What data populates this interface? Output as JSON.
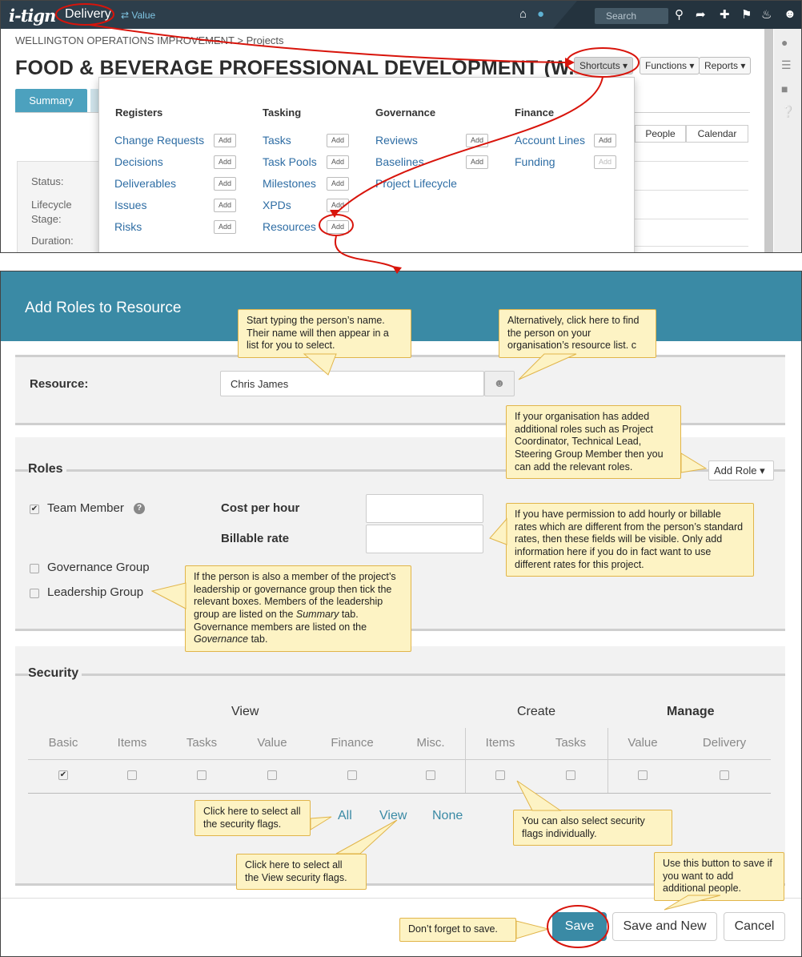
{
  "top": {
    "logo": "i-tign",
    "nav_module": "Delivery",
    "nav_value": "⇄ Value",
    "search_placeholder": "Search",
    "breadcrumb": "WELLINGTON OPERATIONS IMPROVEMENT > Projects",
    "title": "FOOD & BEVERAGE PROFESSIONAL DEVELOPMENT (W...",
    "shortcuts": "Shortcuts ▾",
    "functions": "Functions ▾",
    "reports": "Reports ▾",
    "tab_summary": "Summary",
    "seg_people": "People",
    "seg_calendar": "Calendar",
    "summary_labels": [
      "Status:",
      "Lifecycle",
      "Stage:",
      "Duration:"
    ],
    "dropdown": {
      "columns": [
        {
          "heading": "Registers",
          "items": [
            {
              "label": "Change Requests",
              "add": "Add"
            },
            {
              "label": "Decisions",
              "add": "Add"
            },
            {
              "label": "Deliverables",
              "add": "Add"
            },
            {
              "label": "Issues",
              "add": "Add"
            },
            {
              "label": "Risks",
              "add": "Add"
            }
          ]
        },
        {
          "heading": "Tasking",
          "items": [
            {
              "label": "Tasks",
              "add": "Add"
            },
            {
              "label": "Task Pools",
              "add": "Add"
            },
            {
              "label": "Milestones",
              "add": "Add"
            },
            {
              "label": "XPDs",
              "add": "Add"
            },
            {
              "label": "Resources",
              "add": "Add"
            }
          ]
        },
        {
          "heading": "Governance",
          "items": [
            {
              "label": "Reviews",
              "add": "Add"
            },
            {
              "label": "Baselines",
              "add": "Add"
            },
            {
              "label": "Project Lifecycle",
              "add": ""
            }
          ]
        },
        {
          "heading": "Finance",
          "items": [
            {
              "label": "Account Lines",
              "add": "Add"
            },
            {
              "label": "Funding",
              "add": "Add"
            }
          ]
        }
      ]
    }
  },
  "modal": {
    "title": "Add Roles to Resource",
    "resource_label": "Resource:",
    "resource_value": "Chris James",
    "roles_title": "Roles",
    "add_role": "Add Role ▾",
    "team_member": "Team Member",
    "governance_group": "Governance Group",
    "leadership_group": "Leadership Group",
    "cost_per_hour": "Cost per hour",
    "billable_rate": "Billable rate",
    "security_title": "Security",
    "group_view": "View",
    "group_create": "Create",
    "group_manage": "Manage",
    "sec_cols": [
      "Basic",
      "Items",
      "Tasks",
      "Value",
      "Finance",
      "Misc.",
      "Items",
      "Tasks",
      "Value",
      "Delivery"
    ],
    "sec_checked": [
      true,
      false,
      false,
      false,
      false,
      false,
      false,
      false,
      false,
      false
    ],
    "link_all": "All",
    "link_view": "View",
    "link_none": "None",
    "save": "Save",
    "save_new": "Save and New",
    "cancel": "Cancel"
  },
  "callouts": {
    "type_name": "Start typing the person’s name. Their name will then appear in a list for you to select.",
    "resource_list": "Alternatively, click here to find the person on your organisation’s resource list. c",
    "add_roles": "If your organisation has added additional roles such as Project Coordinator, Technical Lead, Steering Group Member then you can add the relevant roles.",
    "rates": "If you have permission to add hourly or billable rates which are different from the person’s standard rates, then these fields will be visible. Only add information here if you do in fact want to use different rates for this project.",
    "groups_1": "If the person is also a member of the project’s leadership or governance group then tick the relevant boxes.  Members of the leadership group are listed on the ",
    "groups_summary": "Summary",
    "groups_2": " tab. Governance members are listed on the ",
    "groups_governance": "Governance",
    "groups_3": " tab.",
    "select_all": "Click here to select all the security flags.",
    "select_view": "Click here to select all the View security flags.",
    "individual": "You can also select security flags individually.",
    "save_new_tip": "Use this button to save if you want to add additional people.",
    "dont_forget": "Don’t forget to save."
  }
}
